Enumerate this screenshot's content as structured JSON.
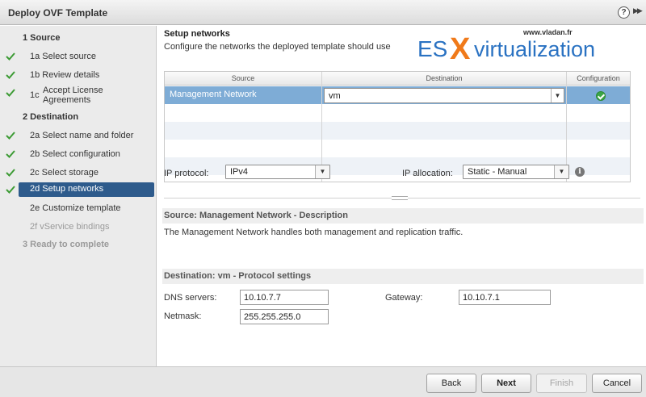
{
  "window": {
    "title": "Deploy OVF Template",
    "help_label": "?",
    "expand_label": "▶▶"
  },
  "sidebar": {
    "steps": [
      {
        "label": "1  Source",
        "completed": false,
        "state": "group"
      },
      {
        "label": "1a  Select source",
        "completed": true,
        "state": "done"
      },
      {
        "label": "1b  Review details",
        "completed": true,
        "state": "done"
      },
      {
        "label": "1c  Accept License\nAgreements",
        "line1": "Accept License",
        "line2": "Agreements",
        "prefix": "1c",
        "completed": true,
        "state": "done"
      },
      {
        "label": "2  Destination",
        "completed": false,
        "state": "group"
      },
      {
        "label": "2a  Select name and folder",
        "completed": true,
        "state": "done"
      },
      {
        "label": "2b  Select configuration",
        "completed": true,
        "state": "done"
      },
      {
        "label": "2c  Select storage",
        "completed": true,
        "state": "done"
      },
      {
        "label": "2d  Setup networks",
        "completed": true,
        "state": "selected"
      },
      {
        "label": "2e  Customize template",
        "completed": false,
        "state": "pending"
      },
      {
        "label": "2f  vService bindings",
        "completed": false,
        "state": "disabled"
      },
      {
        "label": "3  Ready to complete",
        "completed": false,
        "state": "disabled"
      }
    ]
  },
  "main": {
    "title": "Setup networks",
    "subtitle": "Configure the networks the deployed template should use",
    "logo": {
      "url_text": "www.vladan.fr",
      "brand_es": "ES",
      "brand_x": "X",
      "brand_rest": "virtualization"
    },
    "grid": {
      "columns": [
        "Source",
        "Destination",
        "Configuration"
      ],
      "rows": [
        {
          "source": "Management Network",
          "destination": "vm",
          "config_status": "ok"
        }
      ]
    },
    "ip_protocol": {
      "label": "IP protocol:",
      "value": "IPv4"
    },
    "ip_allocation": {
      "label": "IP allocation:",
      "value": "Static - Manual"
    },
    "description": {
      "header": "Source: Management Network - Description",
      "text": "The Management Network handles both management and replication traffic."
    },
    "protocol_settings": {
      "header": "Destination: vm - Protocol settings",
      "dns_label": "DNS servers:",
      "dns_value": "10.10.7.7",
      "gateway_label": "Gateway:",
      "gateway_value": "10.10.7.1",
      "netmask_label": "Netmask:",
      "netmask_value": "255.255.255.0"
    }
  },
  "footer": {
    "back": "Back",
    "next": "Next",
    "finish": "Finish",
    "cancel": "Cancel"
  },
  "colors": {
    "selected_step": "#2e5b8c",
    "selected_row": "#7eacd6",
    "check_green": "#3d9b35",
    "logo_blue": "#2a72c2",
    "logo_orange": "#f07a1a"
  }
}
